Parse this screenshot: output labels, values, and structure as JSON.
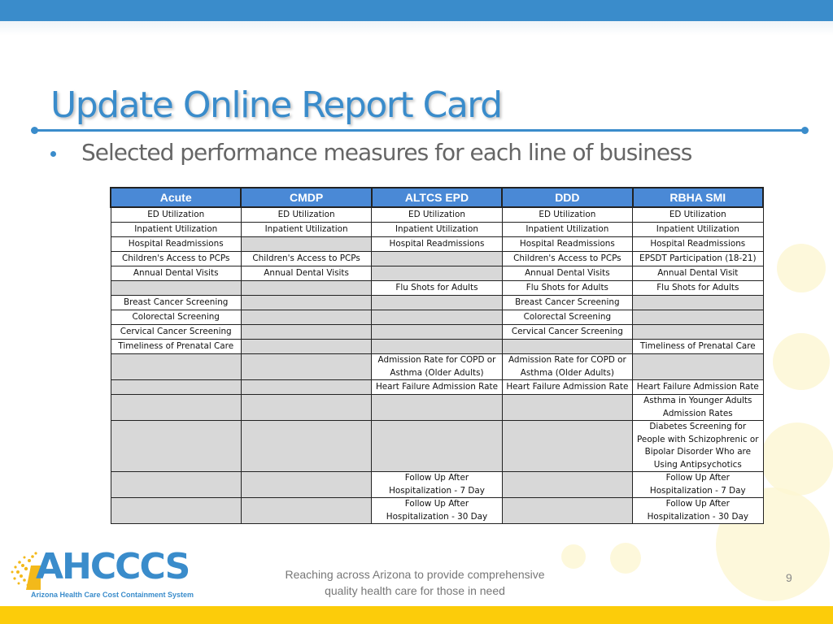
{
  "slide": {
    "title": "Update Online Report Card",
    "bullet": "Selected performance measures for each line of business",
    "page_number": "9"
  },
  "table": {
    "headers": [
      "Acute",
      "CMDP",
      "ALTCS EPD",
      "DDD",
      "RBHA SMI"
    ],
    "rows": [
      [
        "ED Utilization",
        "ED Utilization",
        "ED Utilization",
        "ED Utilization",
        "ED Utilization"
      ],
      [
        "Inpatient Utilization",
        "Inpatient Utilization",
        "Inpatient Utilization",
        "Inpatient Utilization",
        "Inpatient Utilization"
      ],
      [
        "Hospital Readmissions",
        "",
        "Hospital Readmissions",
        "Hospital Readmissions",
        "Hospital Readmissions"
      ],
      [
        "Children's Access to PCPs",
        "Children's Access to PCPs",
        "",
        "Children's Access to PCPs",
        "EPSDT Participation (18-21)"
      ],
      [
        "Annual Dental Visits",
        "Annual Dental Visits",
        "",
        "Annual Dental Visits",
        "Annual Dental Visit"
      ],
      [
        "",
        "",
        "Flu Shots for Adults",
        "Flu Shots for Adults",
        "Flu Shots for Adults"
      ],
      [
        "Breast Cancer Screening",
        "",
        "",
        "Breast Cancer Screening",
        ""
      ],
      [
        "Colorectal Screening",
        "",
        "",
        "Colorectal Screening",
        ""
      ],
      [
        "Cervical Cancer Screening",
        "",
        "",
        "Cervical Cancer Screening",
        ""
      ],
      [
        "Timeliness of Prenatal Care",
        "",
        "",
        "",
        "Timeliness of Prenatal Care"
      ],
      [
        "",
        "",
        "Admission Rate for COPD or Asthma (Older Adults)",
        "Admission Rate for COPD or Asthma (Older Adults)",
        ""
      ],
      [
        "",
        "",
        "Heart Failure Admission Rate",
        "Heart Failure Admission Rate",
        "Heart Failure Admission Rate"
      ],
      [
        "",
        "",
        "",
        "",
        "Asthma in Younger Adults Admission Rates"
      ],
      [
        "",
        "",
        "",
        "",
        "Diabetes Screening for People with Schizophrenic or Bipolar Disorder Who are Using Antipsychotics"
      ],
      [
        "",
        "",
        "Follow Up After Hospitalization - 7 Day",
        "",
        "Follow Up After Hospitalization - 7 Day"
      ],
      [
        "",
        "",
        "Follow Up After Hospitalization - 30 Day",
        "",
        "Follow Up After Hospitalization - 30 Day"
      ]
    ]
  },
  "footer": {
    "logo_text": "AHCCCS",
    "logo_subtitle": "Arizona Health Care Cost Containment System",
    "tagline_line1": "Reaching across Arizona to provide comprehensive",
    "tagline_line2": "quality health care for those in need"
  },
  "colors": {
    "brand_blue": "#3a8ccb",
    "header_blue": "#4a89d6",
    "footer_yellow": "#fccc0a",
    "empty_cell_gray": "#d8d8d8"
  }
}
